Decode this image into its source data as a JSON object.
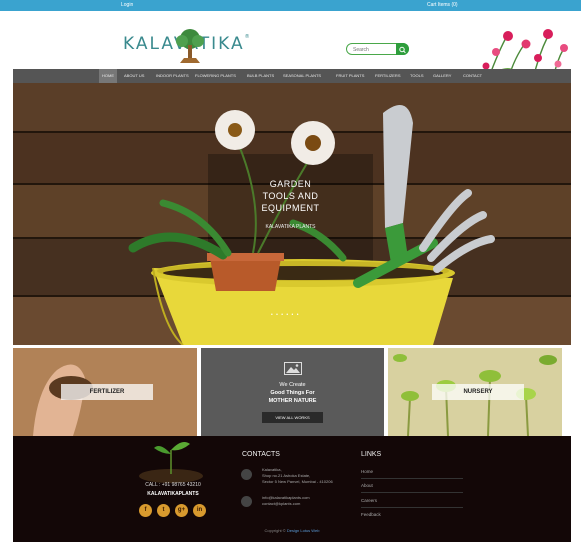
{
  "topbar": {
    "login": "Login",
    "cart": "Cart Items (0)"
  },
  "brand": {
    "logo_text": "KALAVATIKA",
    "logo_mark": "®"
  },
  "search": {
    "placeholder": "Search"
  },
  "nav": {
    "items": [
      "Home",
      "About Us",
      "Indoor Plants",
      "Flowering Plants",
      "Bulb Plants",
      "Seasonal Plants",
      "Fruit Plants",
      "Fertilizers",
      "Tools",
      "Gallery",
      "Contact"
    ]
  },
  "hero": {
    "title": "Garden Tools and Equipment",
    "subtitle": "KALAVATIKA PLANTS",
    "dots": "• • • • • •"
  },
  "tiles": {
    "fertilizer": "FERTILIZER",
    "nursery": "NURSERY",
    "center_line1": "We Create",
    "center_line2": "Good Things For",
    "center_line3": "MOTHER NATURE",
    "button": "View all works"
  },
  "footer": {
    "call": "CALL : +91 98765 43210",
    "brand": "KALAVATIKAPLANTS",
    "social": [
      "f",
      "t",
      "g+",
      "in"
    ],
    "contacts_heading": "CONTACTS",
    "address_line1": "Kalavatika,",
    "address_line2": "Shop no.21 Ashoka Estate,",
    "address_line3": "Sector 5 New Panvel, Mumbai - 410206",
    "email_line1": "info@kalavatikaplants.com",
    "email_line2": "contact@kplants.com",
    "links_heading": "LINKS",
    "links": [
      "Home",
      "About",
      "Careers",
      "Feedback"
    ],
    "copyright": "Copyright © ",
    "developer": "Design Lotus Web"
  },
  "colors": {
    "topbar": "#3aa3cf",
    "logo": "#3a8a8e",
    "nav": "#555555",
    "footer": "#130707",
    "social": "#d89a2e",
    "search_button": "#2e9e3c"
  }
}
